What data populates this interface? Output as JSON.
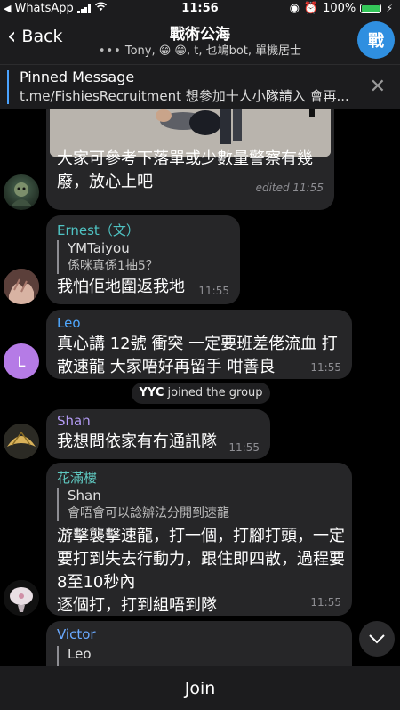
{
  "status": {
    "carrier": "WhatsApp",
    "time": "11:56",
    "battery": "100%",
    "battery_level": 1.0
  },
  "header": {
    "back_label": "Back",
    "title": "戰術公海",
    "subtitle": "Tony, 😁 😁, t, 乜鳩bot, 單機居士",
    "avatar_letter": "戰"
  },
  "pinned": {
    "label": "Pinned Message",
    "text": "t.me/FishiesRecruitment 想參加十人小隊請入 會再..."
  },
  "messages": [
    {
      "sender": "",
      "text": "大家可參考下落單或少數量警察有幾廢，放心上吧",
      "time": "edited 11:55"
    },
    {
      "sender": "Ernest（文）",
      "reply_name": "YMTaiyou",
      "reply_text": "係咪真係1抽5？",
      "text": "我怕佢地圍返我地",
      "time": "11:55"
    },
    {
      "sender": "Leo",
      "avatar_letter": "L",
      "text": "真心講 12號 衝突 一定要班差佬流血 打散速龍 大家唔好再留手 咁善良",
      "time": "11:55"
    },
    {
      "system_name": "YYC",
      "system_text": "joined the group"
    },
    {
      "sender": "Shan",
      "text": "我想問依家有冇通訊隊",
      "time": "11:55"
    },
    {
      "sender": "花滿樓",
      "reply_name": "Shan",
      "reply_text": "會唔會可以諗辦法分開到速龍",
      "text": "游擊襲擊速龍，打一個，打腳打頭，一定要打到失去行動力，跟住即四散，過程要8至10秒內\n逐個打，打到組唔到隊",
      "time": "11:55"
    },
    {
      "sender": "Victor",
      "reply_name": "Leo"
    }
  ],
  "join_label": "Join",
  "colors": {
    "accent": "#4aa3ff",
    "ernest": "#4fc3c3",
    "leo": "#4fa8ff",
    "shan": "#b49cf5",
    "fanlau": "#5fc8c0",
    "victor": "#6aa9ff"
  }
}
